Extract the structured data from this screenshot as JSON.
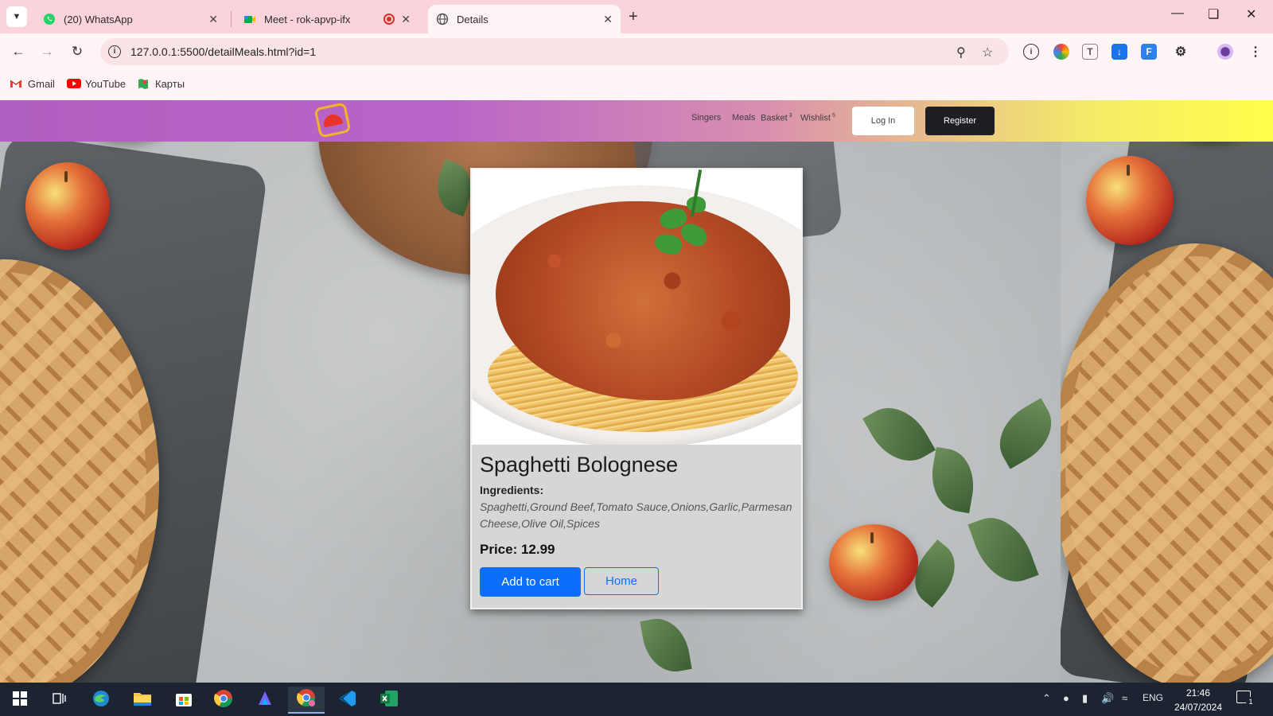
{
  "browser": {
    "tabs": [
      {
        "title": "(20) WhatsApp",
        "active": false
      },
      {
        "title": "Meet - rok-apvp-ifx",
        "active": false
      },
      {
        "title": "Details",
        "active": true
      }
    ],
    "url": "127.0.0.1:5500/detailMeals.html?id=1",
    "bookmarks": [
      "Gmail",
      "YouTube",
      "Карты"
    ]
  },
  "navbar": {
    "links": [
      {
        "label": "Singers",
        "badge": ""
      },
      {
        "label": "Meals",
        "badge": ""
      },
      {
        "label": "Basket",
        "badge": "3"
      },
      {
        "label": "Wishlist",
        "badge": "5"
      }
    ],
    "login_label": "Log In",
    "register_label": "Register"
  },
  "meal": {
    "title": "Spaghetti Bolognese",
    "ingredients_label": "Ingredients:",
    "ingredients": "Spaghetti,Ground Beef,Tomato Sauce,Onions,Garlic,Parmesan Cheese,Olive Oil,Spices",
    "price_text": "Price: 12.99",
    "add_to_cart_label": "Add to cart",
    "home_label": "Home"
  },
  "taskbar": {
    "language": "ENG",
    "time": "21:46",
    "date": "24/07/2024",
    "notification_count": "1"
  },
  "colors": {
    "primary": "#0d6efd",
    "register_bg": "#1d1f24",
    "card_bg": "#d6d6d6",
    "navbar_gradient_start": "#b060c0",
    "navbar_gradient_end": "#ffff4a"
  }
}
